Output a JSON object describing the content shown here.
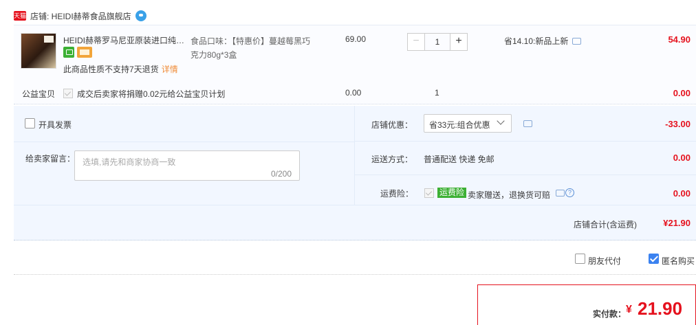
{
  "shop": {
    "badge": "天猫",
    "name": "店铺: HEIDI赫蒂食品旗舰店"
  },
  "item": {
    "title": "HEIDI赫蒂罗马尼亚原装进口纯…",
    "return_note": "此商品性质不支持7天退货",
    "return_detail": "详情",
    "sku_line1": "食品口味：【特惠价】蔓越莓黑巧",
    "sku_line2": "克力80g*3盒",
    "unit_price": "69.00",
    "quantity": "1",
    "qty_minus": "−",
    "qty_plus": "+",
    "promo": "省14.10:新品上新",
    "total": "54.90"
  },
  "charity": {
    "label": "公益宝贝",
    "text": "成交后卖家将捐赠0.02元给公益宝贝计划",
    "price": "0.00",
    "qty": "1",
    "total": "0.00"
  },
  "invoice": {
    "label": "开具发票"
  },
  "message": {
    "label": "给卖家留言：",
    "placeholder": "选填,请先和商家协商一致",
    "count": "0/200"
  },
  "discount": {
    "label": "店铺优惠：",
    "selected": "省33元:组合优惠",
    "amount": "-33.00"
  },
  "shipping": {
    "label": "运送方式：",
    "value": "普通配送 快递 免邮",
    "amount": "0.00"
  },
  "insurance": {
    "label": "运费险：",
    "tag": "运费险",
    "text": "卖家赠送，退换货可赔",
    "help": "?",
    "amount": "0.00"
  },
  "shop_total": {
    "label": "店铺合计(含运费)",
    "amount": "¥21.90"
  },
  "options": {
    "friend_pay": "朋友代付",
    "anonymous": "匿名购买",
    "anonymous_checked": true
  },
  "payment": {
    "label": "实付款：",
    "currency": "¥",
    "amount": "21.90"
  }
}
